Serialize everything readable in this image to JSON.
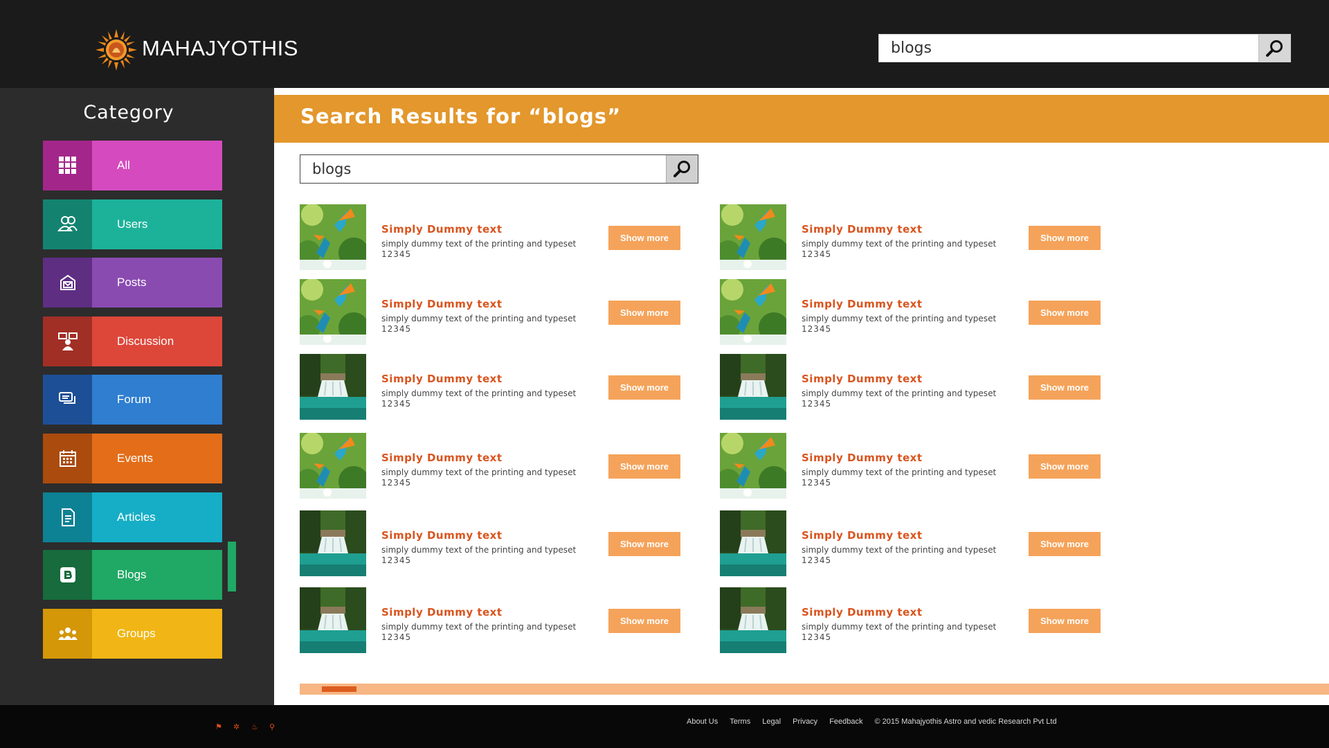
{
  "header": {
    "brand": "MAHAJYOTHIS",
    "search": {
      "value": "blogs"
    }
  },
  "sidebar": {
    "title": "Category",
    "items": [
      {
        "label": "All",
        "icon": "grid-icon",
        "dark": "#a3268a",
        "light": "#d54bbf"
      },
      {
        "label": "Users",
        "icon": "users-icon",
        "dark": "#138370",
        "light": "#1cb29a"
      },
      {
        "label": "Posts",
        "icon": "mail-icon",
        "dark": "#5e2e83",
        "light": "#8a4bb1"
      },
      {
        "label": "Discussion",
        "icon": "discussion-icon",
        "dark": "#a22f26",
        "light": "#dd473a"
      },
      {
        "label": "Forum",
        "icon": "chat-icon",
        "dark": "#1d4f96",
        "light": "#2f7ed0"
      },
      {
        "label": "Events",
        "icon": "calendar-icon",
        "dark": "#ab4b0e",
        "light": "#e36d19"
      },
      {
        "label": "Articles",
        "icon": "document-icon",
        "dark": "#0d8294",
        "light": "#16aec6"
      },
      {
        "label": "Blogs",
        "icon": "blogger-icon",
        "dark": "#176b3c",
        "light": "#20a865"
      },
      {
        "label": "Groups",
        "icon": "groups-icon",
        "dark": "#d39707",
        "light": "#f1b615"
      }
    ]
  },
  "main": {
    "results_title": "Search Results for “blogs”",
    "search": {
      "value": "blogs"
    },
    "results": [
      {
        "title": "Simply Dummy text",
        "desc": "simply dummy text of the printing and typeset",
        "num": "12345",
        "button": "Show more",
        "image": "kingfisher"
      },
      {
        "title": "Simply Dummy text",
        "desc": "simply dummy text of the printing and typeset",
        "num": "12345",
        "button": "Show more",
        "image": "kingfisher"
      },
      {
        "title": "Simply Dummy text",
        "desc": "simply dummy text of the printing and typeset",
        "num": "12345",
        "button": "Show more",
        "image": "kingfisher"
      },
      {
        "title": "Simply Dummy text",
        "desc": "simply dummy text of the printing and typeset",
        "num": "12345",
        "button": "Show more",
        "image": "kingfisher"
      },
      {
        "title": "Simply Dummy text",
        "desc": "simply dummy text of the printing and typeset",
        "num": "12345",
        "button": "Show more",
        "image": "waterfall"
      },
      {
        "title": "Simply Dummy text",
        "desc": "simply dummy text of the printing and typeset",
        "num": "12345",
        "button": "Show more",
        "image": "waterfall"
      },
      {
        "title": "Simply Dummy text",
        "desc": "simply dummy text of the printing and typeset",
        "num": "12345",
        "button": "Show more",
        "image": "kingfisher"
      },
      {
        "title": "Simply Dummy text",
        "desc": "simply dummy text of the printing and typeset",
        "num": "12345",
        "button": "Show more",
        "image": "kingfisher"
      },
      {
        "title": "Simply Dummy text",
        "desc": "simply dummy text of the printing and typeset",
        "num": "12345",
        "button": "Show more",
        "image": "waterfall"
      },
      {
        "title": "Simply Dummy text",
        "desc": "simply dummy text of the printing and typeset",
        "num": "12345",
        "button": "Show more",
        "image": "waterfall"
      },
      {
        "title": "Simply Dummy text",
        "desc": "simply dummy text of the printing and typeset",
        "num": "12345",
        "button": "Show more",
        "image": "waterfall"
      },
      {
        "title": "Simply Dummy text",
        "desc": "simply dummy text of the printing and typeset",
        "num": "12345",
        "button": "Show more",
        "image": "waterfall"
      }
    ],
    "scroll_position": 0.01
  },
  "footer": {
    "icons": [
      "flag-icon",
      "gear-icon",
      "fire-icon",
      "search-icon"
    ],
    "links": [
      "About Us",
      "Terms",
      "Legal",
      "Privacy",
      "Feedback"
    ],
    "copyright": "© 2015 Mahajyothis Astro and vedic Research Pvt Ltd"
  },
  "colors": {
    "header_bg": "#1b1b1b",
    "sidebar_bg": "#2c2c2c",
    "results_bar": "#e3972c",
    "title_text": "#d9541e",
    "button": "#f5a35a",
    "scroll_track": "#f7b684",
    "scroll_thumb": "#dd5c1e"
  }
}
